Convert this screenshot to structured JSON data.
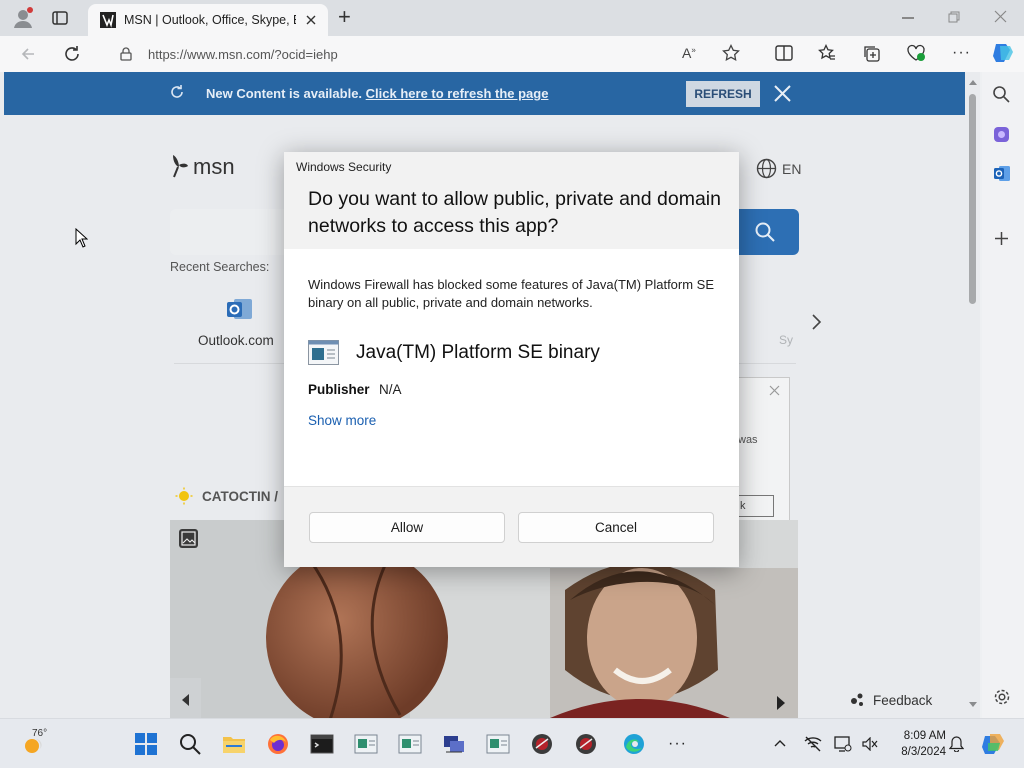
{
  "browser": {
    "tab_title": "MSN | Outlook, Office, Skype, Bi",
    "url": "https://www.msn.com/?ocid=iehp",
    "new_tab_symbol": "+"
  },
  "banner": {
    "text": "New Content is available.",
    "link": "Click here to refresh the page",
    "refresh_label": "REFRESH"
  },
  "msn": {
    "logo": "msn",
    "language": "EN",
    "recent_searches_label": "Recent Searches:",
    "quick_link": "Outlook.com",
    "partial_link": "Sy",
    "weather_location": "CATOCTIN /",
    "feedback": "Feedback",
    "mini_dialog_text": "was",
    "mini_dialog_button": "k"
  },
  "dialog": {
    "caption": "Windows Security",
    "question": "Do you want to allow public, private and domain networks to access this app?",
    "body": "Windows Firewall has blocked some features of Java(TM) Platform SE binary on all public, private and domain networks.",
    "app_name": "Java(TM) Platform SE binary",
    "publisher_label": "Publisher",
    "publisher_value": "N/A",
    "show_more": "Show more",
    "allow_label": "Allow",
    "cancel_label": "Cancel"
  },
  "taskbar": {
    "temperature": "76°",
    "time": "8:09 AM",
    "date": "8/3/2024"
  },
  "colors": {
    "banner": "#2866a3",
    "link": "#1a5fb0",
    "search_button": "#2d6fb4"
  }
}
